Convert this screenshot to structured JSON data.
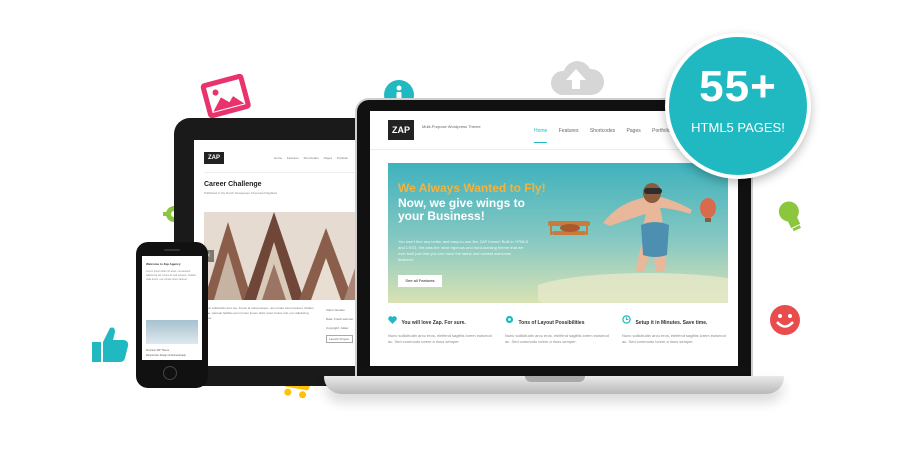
{
  "badge": {
    "number": "55+",
    "label": "HTML5 PAGES!"
  },
  "colors": {
    "accent": "#20b9c1",
    "orange": "#f7b23a",
    "pink": "#e8336d",
    "green": "#8cc63f",
    "red": "#e94c4c",
    "yellow": "#ffc107"
  },
  "icons": [
    "image-icon",
    "info-icon",
    "cloud-upload-icon",
    "lightbulb-icon",
    "smiley-icon",
    "thumbs-up-icon",
    "cart-icon",
    "gear-icon"
  ],
  "laptop_site": {
    "logo": "ZAP",
    "tagline": "Multi-Purpose Wordpress Theme",
    "nav": [
      "Home",
      "Features",
      "Shortcodes",
      "Pages",
      "Portfolio"
    ],
    "hero_heading": "We Always Wanted to Fly!",
    "hero_subheading": "Now, we give wings to your Business!",
    "hero_text": "You won't find any better and easy-to-use like ZAP theme! Built in HTML5 and CSS3, this was the most rigorous and hard-working theme that we ever built just that you can have the latest and newest awesome features!",
    "hero_button": "See all Features",
    "columns": [
      {
        "title": "You will love Zap. For sure.",
        "text": "Nunc sollicitudin arcu eros, eleifend sagittis lorem euismod ac. Sed commodo lorem a risus semper."
      },
      {
        "title": "Tons of Layout Possibilities",
        "text": "Nunc sollicitudin arcu eros, eleifend sagittis lorem euismod ac. Sed commodo lorem a risus semper."
      },
      {
        "title": "Setup it in Minutes. Save time.",
        "text": "Nunc sollicitudin arcu eros, eleifend sagittis lorem euismod ac. Sed commodo lorem a risus semper."
      }
    ]
  },
  "tablet_site": {
    "logo": "ZAP",
    "nav": [
      "Home",
      "Features",
      "Shortcodes",
      "Pages",
      "Portfolio"
    ],
    "title": "Career Challenge",
    "subtitle": "Published in the Dutch Newspaper Financieel Dagblad",
    "text": "Nunc sollicitudin arcu leo. Fusce at velit posuere, nec ornare lorem laoreet. Nullam vitae. Aenean facilisis est in lorem ipsum dolor amet cursus nisi, nec adipiscing lacus.",
    "meta": [
      "Client: Envato",
      "Date: Fresh summer",
      "Copyright: Julian"
    ],
    "button": "Launch Project"
  },
  "phone_site": {
    "title": "Welcome to Zap Agency",
    "text": "Lorem ipsum dolor sit amet, consectetur adipiscing elit. Fusce at velit posuere. Nullam vitae lorem, nec ornare lorem laoreet.",
    "links": [
      "Premium WP Theme",
      "Responsive Design & Retina Ready"
    ]
  }
}
